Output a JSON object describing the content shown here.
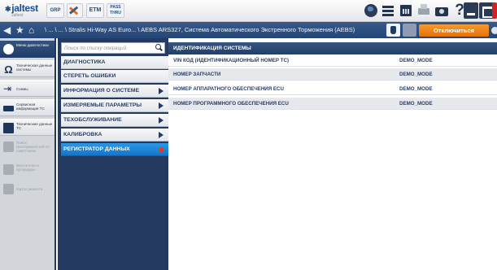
{
  "app": {
    "logo_text": "jaltest",
    "logo_tagline": "Jaltest",
    "group_button": "GRP",
    "etm_button": "ETM",
    "pass_thru_line1": "PASS",
    "pass_thru_line2": "THRU",
    "help_glyph": "?"
  },
  "nav": {
    "breadcrumb": "\\ ... \\ ... \\ Stralis Hi-Way AS Euro... \\ AEBS ARS327, Система Автоматического Экстренного Торможения (AEBS)",
    "disconnect_label": "Отключиться"
  },
  "sidebar": {
    "items": [
      {
        "label": "Меню диагностики"
      },
      {
        "label": "Техническая данные системы"
      },
      {
        "label": "Схемы"
      },
      {
        "label": "Сервисная информация ТС"
      },
      {
        "label": "Технические данные ТС"
      },
      {
        "label": "Поиск неисправностей по симптомам"
      },
      {
        "label": "Бюллетени и процедуры"
      },
      {
        "label": "Карты ремонта"
      }
    ]
  },
  "menu": {
    "search_placeholder": "Поиск по списку операций",
    "items": [
      {
        "label": "ДИАГНОСТИКА"
      },
      {
        "label": "СТЕРЕТЬ ОШИБКИ"
      },
      {
        "label": "ИНФОРМАЦИЯ О СИСТЕМЕ"
      },
      {
        "label": "ИЗМЕРЯЕМЫЕ ПАРАМЕТРЫ"
      },
      {
        "label": "ТЕХОБСЛУЖИВАНИЕ"
      },
      {
        "label": "КАЛИБРОВКА"
      },
      {
        "label": "РЕГИСТРАТОР ДАННЫХ"
      }
    ],
    "selected_index": 6
  },
  "table": {
    "header": "ИДЕНТИФИКАЦИЯ СИСТЕМЫ",
    "rows": [
      {
        "name": "VIN КОД (ИДЕНТИФИКАЦИОННЫЙ НОМЕР ТС)",
        "value": "DEMO_MODE"
      },
      {
        "name": "НОМЕР ЗАПЧАСТИ",
        "value": "DEMO_MODE"
      },
      {
        "name": "НОМЕР АППАРАТНОГО ОБЕСПЕЧЕНИЯ ECU",
        "value": "DEMO_MODE"
      },
      {
        "name": "НОМЕР ПРОГРАММНОГО ОБЕСПЕЧЕНИЯ ECU",
        "value": "DEMO_MODE"
      }
    ]
  },
  "colors": {
    "nav_blue": "#254777",
    "selected_blue": "#1675c8",
    "disconnect_orange": "#e2700b",
    "close_red": "#d12323"
  }
}
